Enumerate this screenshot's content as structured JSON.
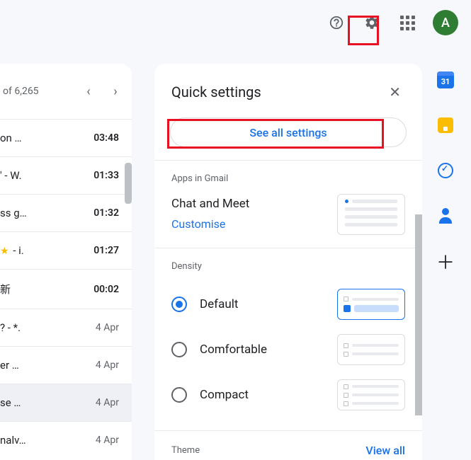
{
  "topbar": {
    "avatar_initial": "A"
  },
  "calendar_day": "31",
  "inbox": {
    "count_text": "of 6,265",
    "items": [
      {
        "preview": "on …",
        "time": "03:48",
        "star": false,
        "later": false
      },
      {
        "preview": "' - W.",
        "time": "01:33",
        "star": false,
        "later": false
      },
      {
        "preview": "ss g…",
        "time": "01:32",
        "star": false,
        "later": false
      },
      {
        "preview": " - i.",
        "time": "01:27",
        "star": true,
        "later": false
      },
      {
        "preview": "新",
        "time": "00:02",
        "star": false,
        "later": false
      },
      {
        "preview": "? - *.",
        "time": "4 Apr",
        "star": false,
        "later": true
      },
      {
        "preview": "er …",
        "time": "4 Apr",
        "star": false,
        "later": true
      },
      {
        "preview": "se …",
        "time": "4 Apr",
        "star": false,
        "later": true,
        "selected": true
      },
      {
        "preview": "nalv…",
        "time": "4 Apr",
        "star": false,
        "later": true
      }
    ]
  },
  "panel": {
    "title": "Quick settings",
    "see_all": "See all settings",
    "apps_heading": "Apps in Gmail",
    "apps_label": "Chat and Meet",
    "customise": "Customise",
    "density_heading": "Density",
    "density": [
      {
        "label": "Default",
        "selected": true
      },
      {
        "label": "Comfortable",
        "selected": false
      },
      {
        "label": "Compact",
        "selected": false
      }
    ],
    "theme_heading": "Theme",
    "view_all": "View all"
  }
}
